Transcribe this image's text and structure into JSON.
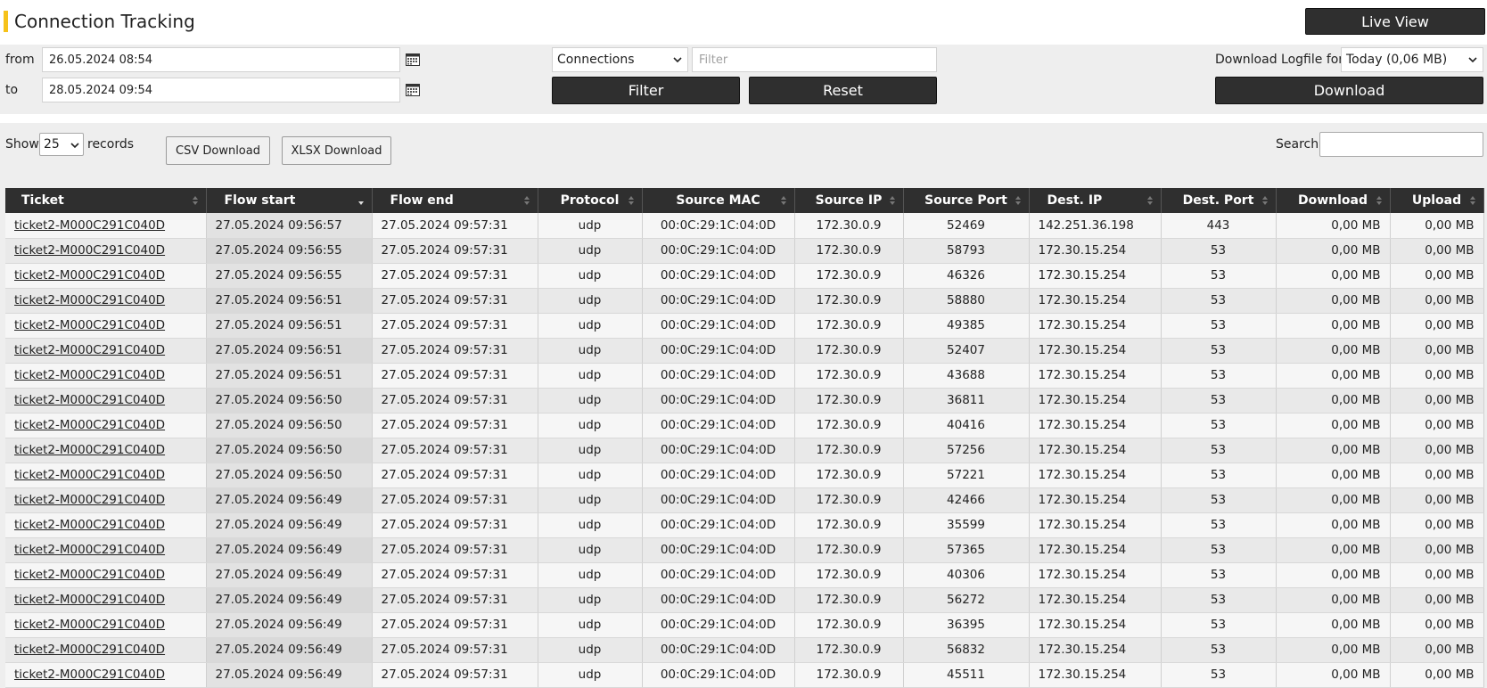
{
  "page": {
    "title": "Connection Tracking",
    "live_view_label": "Live View"
  },
  "filters": {
    "from_label": "from",
    "to_label": "to",
    "from_value": "26.05.2024 08:54",
    "to_value": "28.05.2024 09:54",
    "type_select_value": "Connections",
    "filter_placeholder": "Filter",
    "filter_button": "Filter",
    "reset_button": "Reset",
    "download_logfile_label": "Download Logfile for:",
    "download_logfile_value": "Today (0,06 MB)",
    "download_button": "Download"
  },
  "table_controls": {
    "show_label": "Show",
    "records_value": "25",
    "records_label": "records",
    "csv_download": "CSV Download",
    "xlsx_download": "XLSX Download",
    "search_label": "Search:"
  },
  "table": {
    "columns": [
      "Ticket",
      "Flow start",
      "Flow end",
      "Protocol",
      "Source MAC",
      "Source IP",
      "Source Port",
      "Dest. IP",
      "Dest. Port",
      "Download",
      "Upload"
    ],
    "rows": [
      [
        "ticket2-M000C291C040D",
        "27.05.2024 09:56:57",
        "27.05.2024 09:57:31",
        "udp",
        "00:0C:29:1C:04:0D",
        "172.30.0.9",
        "52469",
        "142.251.36.198",
        "443",
        "0,00 MB",
        "0,00 MB"
      ],
      [
        "ticket2-M000C291C040D",
        "27.05.2024 09:56:55",
        "27.05.2024 09:57:31",
        "udp",
        "00:0C:29:1C:04:0D",
        "172.30.0.9",
        "58793",
        "172.30.15.254",
        "53",
        "0,00 MB",
        "0,00 MB"
      ],
      [
        "ticket2-M000C291C040D",
        "27.05.2024 09:56:55",
        "27.05.2024 09:57:31",
        "udp",
        "00:0C:29:1C:04:0D",
        "172.30.0.9",
        "46326",
        "172.30.15.254",
        "53",
        "0,00 MB",
        "0,00 MB"
      ],
      [
        "ticket2-M000C291C040D",
        "27.05.2024 09:56:51",
        "27.05.2024 09:57:31",
        "udp",
        "00:0C:29:1C:04:0D",
        "172.30.0.9",
        "58880",
        "172.30.15.254",
        "53",
        "0,00 MB",
        "0,00 MB"
      ],
      [
        "ticket2-M000C291C040D",
        "27.05.2024 09:56:51",
        "27.05.2024 09:57:31",
        "udp",
        "00:0C:29:1C:04:0D",
        "172.30.0.9",
        "49385",
        "172.30.15.254",
        "53",
        "0,00 MB",
        "0,00 MB"
      ],
      [
        "ticket2-M000C291C040D",
        "27.05.2024 09:56:51",
        "27.05.2024 09:57:31",
        "udp",
        "00:0C:29:1C:04:0D",
        "172.30.0.9",
        "52407",
        "172.30.15.254",
        "53",
        "0,00 MB",
        "0,00 MB"
      ],
      [
        "ticket2-M000C291C040D",
        "27.05.2024 09:56:51",
        "27.05.2024 09:57:31",
        "udp",
        "00:0C:29:1C:04:0D",
        "172.30.0.9",
        "43688",
        "172.30.15.254",
        "53",
        "0,00 MB",
        "0,00 MB"
      ],
      [
        "ticket2-M000C291C040D",
        "27.05.2024 09:56:50",
        "27.05.2024 09:57:31",
        "udp",
        "00:0C:29:1C:04:0D",
        "172.30.0.9",
        "36811",
        "172.30.15.254",
        "53",
        "0,00 MB",
        "0,00 MB"
      ],
      [
        "ticket2-M000C291C040D",
        "27.05.2024 09:56:50",
        "27.05.2024 09:57:31",
        "udp",
        "00:0C:29:1C:04:0D",
        "172.30.0.9",
        "40416",
        "172.30.15.254",
        "53",
        "0,00 MB",
        "0,00 MB"
      ],
      [
        "ticket2-M000C291C040D",
        "27.05.2024 09:56:50",
        "27.05.2024 09:57:31",
        "udp",
        "00:0C:29:1C:04:0D",
        "172.30.0.9",
        "57256",
        "172.30.15.254",
        "53",
        "0,00 MB",
        "0,00 MB"
      ],
      [
        "ticket2-M000C291C040D",
        "27.05.2024 09:56:50",
        "27.05.2024 09:57:31",
        "udp",
        "00:0C:29:1C:04:0D",
        "172.30.0.9",
        "57221",
        "172.30.15.254",
        "53",
        "0,00 MB",
        "0,00 MB"
      ],
      [
        "ticket2-M000C291C040D",
        "27.05.2024 09:56:49",
        "27.05.2024 09:57:31",
        "udp",
        "00:0C:29:1C:04:0D",
        "172.30.0.9",
        "42466",
        "172.30.15.254",
        "53",
        "0,00 MB",
        "0,00 MB"
      ],
      [
        "ticket2-M000C291C040D",
        "27.05.2024 09:56:49",
        "27.05.2024 09:57:31",
        "udp",
        "00:0C:29:1C:04:0D",
        "172.30.0.9",
        "35599",
        "172.30.15.254",
        "53",
        "0,00 MB",
        "0,00 MB"
      ],
      [
        "ticket2-M000C291C040D",
        "27.05.2024 09:56:49",
        "27.05.2024 09:57:31",
        "udp",
        "00:0C:29:1C:04:0D",
        "172.30.0.9",
        "57365",
        "172.30.15.254",
        "53",
        "0,00 MB",
        "0,00 MB"
      ],
      [
        "ticket2-M000C291C040D",
        "27.05.2024 09:56:49",
        "27.05.2024 09:57:31",
        "udp",
        "00:0C:29:1C:04:0D",
        "172.30.0.9",
        "40306",
        "172.30.15.254",
        "53",
        "0,00 MB",
        "0,00 MB"
      ],
      [
        "ticket2-M000C291C040D",
        "27.05.2024 09:56:49",
        "27.05.2024 09:57:31",
        "udp",
        "00:0C:29:1C:04:0D",
        "172.30.0.9",
        "56272",
        "172.30.15.254",
        "53",
        "0,00 MB",
        "0,00 MB"
      ],
      [
        "ticket2-M000C291C040D",
        "27.05.2024 09:56:49",
        "27.05.2024 09:57:31",
        "udp",
        "00:0C:29:1C:04:0D",
        "172.30.0.9",
        "36395",
        "172.30.15.254",
        "53",
        "0,00 MB",
        "0,00 MB"
      ],
      [
        "ticket2-M000C291C040D",
        "27.05.2024 09:56:49",
        "27.05.2024 09:57:31",
        "udp",
        "00:0C:29:1C:04:0D",
        "172.30.0.9",
        "56832",
        "172.30.15.254",
        "53",
        "0,00 MB",
        "0,00 MB"
      ],
      [
        "ticket2-M000C291C040D",
        "27.05.2024 09:56:49",
        "27.05.2024 09:57:31",
        "udp",
        "00:0C:29:1C:04:0D",
        "172.30.0.9",
        "45511",
        "172.30.15.254",
        "53",
        "0,00 MB",
        "0,00 MB"
      ]
    ]
  },
  "colors": {
    "accent": "#f6c21a",
    "dark_button": "#2f2f2f",
    "panel_bg": "#eeeeee"
  },
  "icons": {
    "calendar": "calendar-icon",
    "sort": "sort-icon",
    "chevron": "chevron-down-icon"
  }
}
